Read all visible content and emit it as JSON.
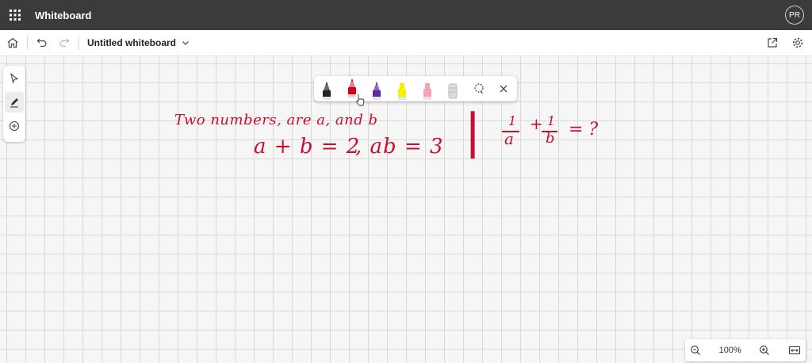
{
  "app": {
    "title": "Whiteboard",
    "avatar_initials": "PR"
  },
  "toolbar": {
    "doc_title": "Untitled whiteboard"
  },
  "ink_toolbar": {
    "pens": [
      {
        "name": "black-pen",
        "color": "#222222"
      },
      {
        "name": "red-pen",
        "color": "#d0021b",
        "selected": true
      },
      {
        "name": "purple-pen",
        "color": "#5b2a9e"
      },
      {
        "name": "yellow-highlighter",
        "color": "#f5f000"
      },
      {
        "name": "pink-highlighter",
        "color": "#f3a4b4"
      },
      {
        "name": "eraser",
        "color": "#d6d6d6"
      }
    ]
  },
  "ink": {
    "line1": "Two numbers, are a, and b",
    "line2a": "a + b = 2",
    "line2b": ", ab = 3",
    "sep": "|",
    "q_num1": "1",
    "q_den1": "a",
    "q_plus": "+",
    "q_num2": "1",
    "q_den2": "b",
    "q_rest": "= ?"
  },
  "zoom": {
    "value": "100%"
  },
  "colors": {
    "ink": "#c8102e",
    "titlebar": "#3b3b3b"
  }
}
